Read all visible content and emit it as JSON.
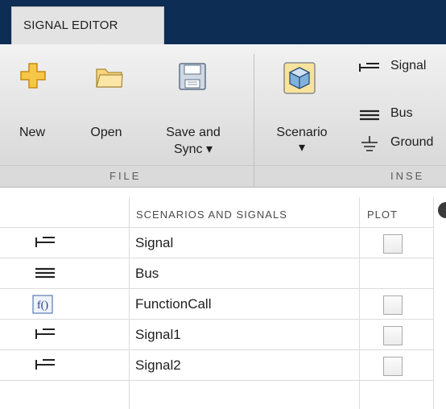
{
  "app": {
    "tab_label": "SIGNAL EDITOR"
  },
  "toolstrip": {
    "sections": {
      "file": "FILE",
      "insert": "INSE"
    },
    "buttons": {
      "new_label": "New",
      "open_label": "Open",
      "save_label_line1": "Save and",
      "save_label_line2": "Sync ▾",
      "scenario_label": "Scenario",
      "scenario_arrow": "▾"
    },
    "insert_items": [
      {
        "label": "Signal",
        "icon": "signal-icon"
      },
      {
        "label": "Bus",
        "icon": "bus-icon"
      },
      {
        "label": "Ground",
        "icon": "ground-icon"
      }
    ]
  },
  "grid": {
    "columns": {
      "name": "SCENARIOS AND SIGNALS",
      "plot": "PLOT"
    },
    "rows": [
      {
        "name": "Signal",
        "icon": "signal-icon",
        "plot_checkbox": true,
        "plot_checked": false
      },
      {
        "name": "Bus",
        "icon": "bus-icon",
        "plot_checkbox": false,
        "plot_checked": false
      },
      {
        "name": "FunctionCall",
        "icon": "function-call-icon",
        "plot_checkbox": true,
        "plot_checked": false
      },
      {
        "name": "Signal1",
        "icon": "signal-icon",
        "plot_checkbox": true,
        "plot_checked": false
      },
      {
        "name": "Signal2",
        "icon": "signal-icon",
        "plot_checkbox": true,
        "plot_checked": false
      }
    ]
  },
  "colors": {
    "tab_strip_bg": "#0d2d55",
    "toolstrip_bg": "#e3e3e3",
    "folder_icon": "#f6c648",
    "new_plus_icon": "#f3b62f"
  }
}
